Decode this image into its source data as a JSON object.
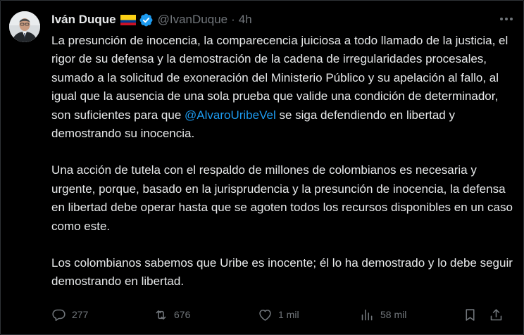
{
  "user": {
    "display_name": "Iván Duque",
    "handle": "@IvanDuque",
    "separator": "·",
    "time": "4h",
    "flag_colors": [
      "#FCD116",
      "#003893",
      "#CE1126"
    ],
    "verified_color": "#1d9bf0"
  },
  "tweet": {
    "p1_before": "La presunción de inocencia, la comparecencia juiciosa a todo llamado de la justicia, el rigor de su defensa y la demostración de la cadena de irregularidades procesales, sumado a la solicitud de exoneración del Ministerio Público y su apelación al fallo, al igual que la ausencia de una sola prueba que valide una condición de determinador, son suficientes para que ",
    "p1_mention": "@AlvaroUribeVel",
    "p1_after": " se siga defendiendo en libertad y demostrando su inocencia.",
    "p2": "Una acción de tutela con el respaldo de millones de colombianos es necesaria y urgente, porque, basado en la jurisprudencia y la presunción de inocencia, la defensa en libertad debe operar hasta que se agoten todos los recursos disponibles en un caso como este.",
    "p3": "Los colombianos sabemos que Uribe es inocente; él lo ha demostrado y lo debe seguir demostrando en libertad."
  },
  "actions": {
    "replies": "277",
    "reposts": "676",
    "likes": "1 mil",
    "views": "58 mil"
  },
  "colors": {
    "background": "#000000",
    "text": "#e7e9ea",
    "muted": "#71767b",
    "link": "#1d9bf0"
  }
}
